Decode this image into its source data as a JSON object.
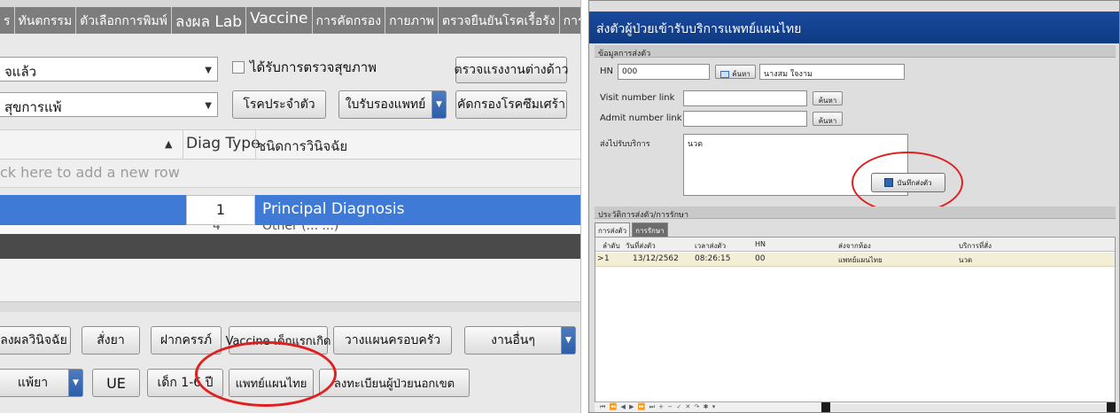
{
  "left": {
    "tabs": [
      "ร",
      "ทันตกรรม",
      "ตัวเลือกการพิมพ์",
      "ลงผล Lab",
      "Vaccine",
      "การคัดกรอง",
      "กายภาพ",
      "ตรวจยืนยันโรคเรื้อรัง",
      "การ"
    ],
    "combo1_value": "จแล้ว",
    "combo2_value": "สุขการแพ้",
    "checkbox_label": "ได้รับการตรวจสุขภาพ",
    "btn_check_foreign": "ตรวจแรงงานต่างด้าว",
    "btn_chronic": "โรคประจำตัว",
    "btn_med_cert": "ใบรับรองแพทย์",
    "btn_screen_depression": "คัดกรองโรคซึมเศร้า",
    "grid": {
      "col_diag_type": "Diag Type",
      "col_diag_type_th": "ชนิดการวินิจฉัย",
      "new_row_hint": "ck here to add a new row",
      "selected_num": "1",
      "selected_text": "Principal Diagnosis",
      "next_row_num": "4",
      "next_row_text": "Other (...                        ...)"
    },
    "bottom_buttons_row1": {
      "diagnosis": "ลงผลวินิจฉัย",
      "order_med": "สั่งยา",
      "antenatal": "ฝากครรภ์",
      "vaccine": "Vaccine เด็กแรกเกิด",
      "family_plan": "วางแผนครอบครัว",
      "other_work": "งานอื่นๆ"
    },
    "bottom_buttons_row2": {
      "allergy": "แพ้ยา",
      "ue": "UE",
      "child": "เด็ก 1-6 ปี",
      "thai_med": "แพทย์แผนไทย",
      "register_out": "ลงทะเบียนผู้ป่วยนอกเขต"
    }
  },
  "right": {
    "title": "ส่งตัวผู้ป่วยเข้ารับบริการแพทย์แผนไทย",
    "section_send_info": "ข้อมูลการส่งตัว",
    "hn_label": "HN",
    "hn_value": "000",
    "search_btn": "ค้นหา",
    "patient_name": "นางสม ใจงาม",
    "visit_label": "Visit number link",
    "admit_label": "Admit number link",
    "send_service_label": "ส่งไปรับบริการ",
    "send_service_value": "นวด",
    "save_btn": "บันทึกส่งตัว",
    "section_history": "ประวัติการส่งตัว/การรักษา",
    "tab_send": "การส่งตัว",
    "tab_treat": "การรักษา",
    "grid_headers": [
      "ลำดับ",
      "วันที่ส่งตัว",
      "เวลาส่งตัว",
      "HN",
      "ส่งจากห้อง",
      "บริการที่สั่ง"
    ],
    "grid_row": [
      "1",
      "13/12/2562",
      "08:26:15",
      "00",
      "แพทย์แผนไทย",
      "นวด"
    ],
    "nav_glyphs": "⏮ ⏪ ◀ ▶ ⏩ ⏭ + − ✓ ✕ ↷ ✱ ▾"
  },
  "colors": {
    "title_blue": "#1b4a9e",
    "selection_blue": "#3f7bd6",
    "highlight_red": "#e02020",
    "row_yellow": "#f3efd7"
  }
}
